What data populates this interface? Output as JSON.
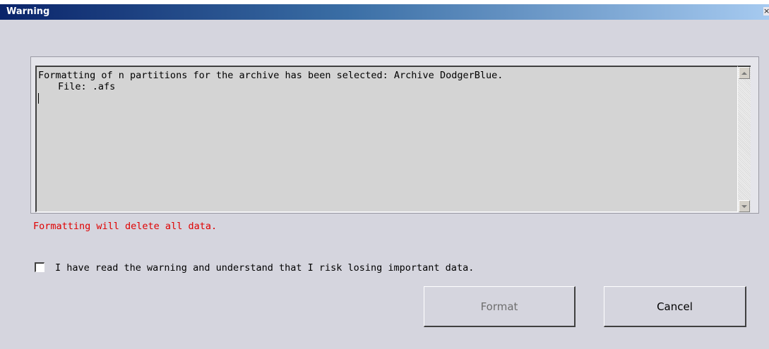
{
  "window": {
    "title": "Warning",
    "close_label": "×"
  },
  "message": {
    "line1": "Formatting of n partitions for the archive has been selected: Archive DodgerBlue.",
    "line2": "File: .afs"
  },
  "warning": "Formatting will delete all data.",
  "acknowledge": {
    "label": "I have read the warning and understand that I risk losing important data.",
    "checked": false
  },
  "buttons": {
    "format_label": "Format",
    "format_enabled": false,
    "cancel_label": "Cancel"
  },
  "colors": {
    "warning": "#e00000",
    "titlebar_start": "#0a246a",
    "titlebar_end": "#a6caf0",
    "dialog_bg": "#d5d5de",
    "disabled_text": "#6e6e6e"
  },
  "icons": {
    "close": "close-icon",
    "scroll_up": "arrow-up-icon",
    "scroll_down": "arrow-down-icon"
  }
}
